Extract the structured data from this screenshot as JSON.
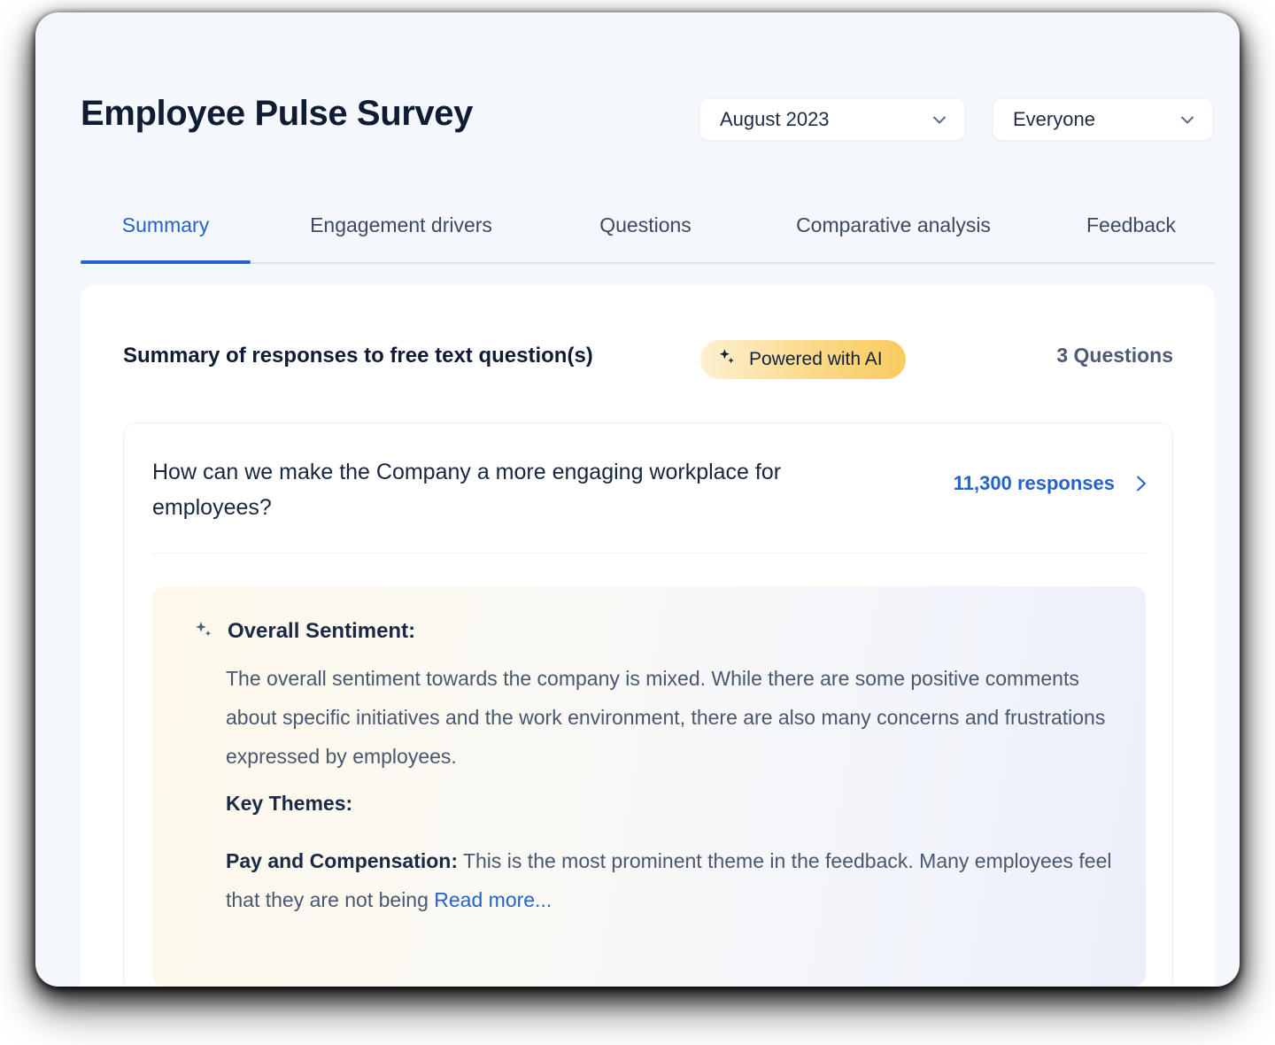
{
  "header": {
    "title": "Employee Pulse Survey",
    "period_dropdown": {
      "value": "August 2023",
      "icon": "chevron-down-icon"
    },
    "audience_dropdown": {
      "value": "Everyone",
      "icon": "chevron-down-icon"
    }
  },
  "tabs": [
    {
      "label": "Summary",
      "active": true
    },
    {
      "label": "Engagement drivers",
      "active": false
    },
    {
      "label": "Questions",
      "active": false
    },
    {
      "label": "Comparative analysis",
      "active": false
    },
    {
      "label": "Feedback",
      "active": false
    }
  ],
  "summary_section": {
    "title": "Summary of responses to free text question(s)",
    "ai_badge": {
      "label": "Powered with AI",
      "icon": "sparkle-icon"
    },
    "questions_count": "3 Questions"
  },
  "question_card": {
    "question": "How can we make the Company a more engaging workplace for employees?",
    "responses_label": "11,300 responses",
    "responses_icon": "chevron-right-icon",
    "ai_summary": {
      "sentiment_icon": "sparkle-icon",
      "sentiment_heading": "Overall Sentiment:",
      "sentiment_body": "The overall sentiment towards the company is mixed. While there are some positive comments about specific initiatives and the work environment, there are also many concerns and frustrations expressed by employees.",
      "themes_heading": "Key Themes:",
      "theme_label": "Pay and Compensation:",
      "theme_body": "This is the most prominent theme in the feedback. Many employees feel that they are not being ",
      "read_more_label": "Read more..."
    }
  },
  "colors": {
    "accent_blue": "#2563c9",
    "title_navy": "#101c33",
    "body_slate": "#49576f",
    "badge_gold": "#f9cb5f",
    "page_bg": "#f4f7fc"
  }
}
